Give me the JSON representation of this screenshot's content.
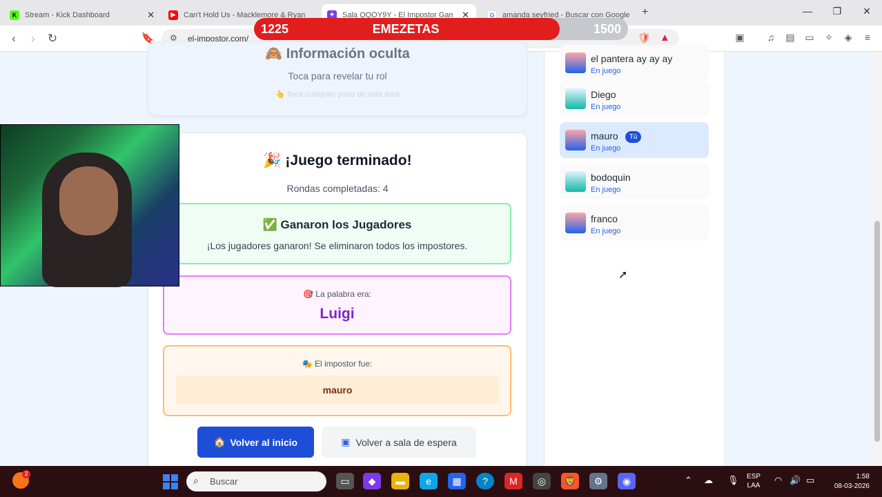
{
  "browser": {
    "tabs": [
      {
        "title": "Stream - Kick Dashboard",
        "icon": "kick-icon",
        "color": "#53fc18",
        "glyph": "K"
      },
      {
        "title": "Can't Hold Us - Macklemore & Ryan",
        "icon": "youtube-icon",
        "color": "#ff0000",
        "glyph": "▶"
      },
      {
        "title": "Sala QQOY9Y - El Impostor Gam",
        "icon": "impostor-icon",
        "color": "#7c3aed",
        "glyph": "✦"
      },
      {
        "title": "amanda seyfried - Buscar con Google",
        "icon": "google-icon",
        "color": "#4285f4",
        "glyph": "G"
      }
    ],
    "new_tab": "+",
    "url": "el-impostor.com/"
  },
  "overlay": {
    "score_left": "1225",
    "title": "EMEZETAS",
    "score_right": "1500",
    "progress": 0.8167,
    "color": "#e11d1d"
  },
  "hidden_card": {
    "title": "Información oculta",
    "subtitle": "Toca para revelar tu rol",
    "hint": "Toca cualquier parte de esta área",
    "hint_icon": "👆"
  },
  "result": {
    "title_icon": "🎉",
    "title": "¡Juego terminado!",
    "rounds": "Rondas completadas: 4",
    "winner_icon": "✅",
    "winner_title": "Ganaron los Jugadores",
    "winner_text": "¡Los jugadores ganaron! Se eliminaron todos los impostores.",
    "word_icon": "🎯",
    "word_label": "La palabra era:",
    "word": "Luigi",
    "impostor_icon": "🎭",
    "impostor_label": "El impostor fue:",
    "impostor": "mauro",
    "home_icon": "🏠",
    "home_button": "Volver al inicio",
    "wait_icon": "▣",
    "wait_button": "Volver a sala de espera"
  },
  "players": [
    {
      "name": "el pantera ay ay ay",
      "status": "En juego",
      "me": false
    },
    {
      "name": "Diego",
      "status": "En juego",
      "me": false
    },
    {
      "name": "mauro",
      "status": "En juego",
      "me": true,
      "badge": "Tú"
    },
    {
      "name": "bodoquin",
      "status": "En juego",
      "me": false
    },
    {
      "name": "franco",
      "status": "En juego",
      "me": false
    }
  ],
  "taskbar": {
    "search": "Buscar",
    "weather_badge": "2",
    "lang": "ESP",
    "lang2": "LAA",
    "time": "1:58",
    "date": "08-03-2026"
  }
}
